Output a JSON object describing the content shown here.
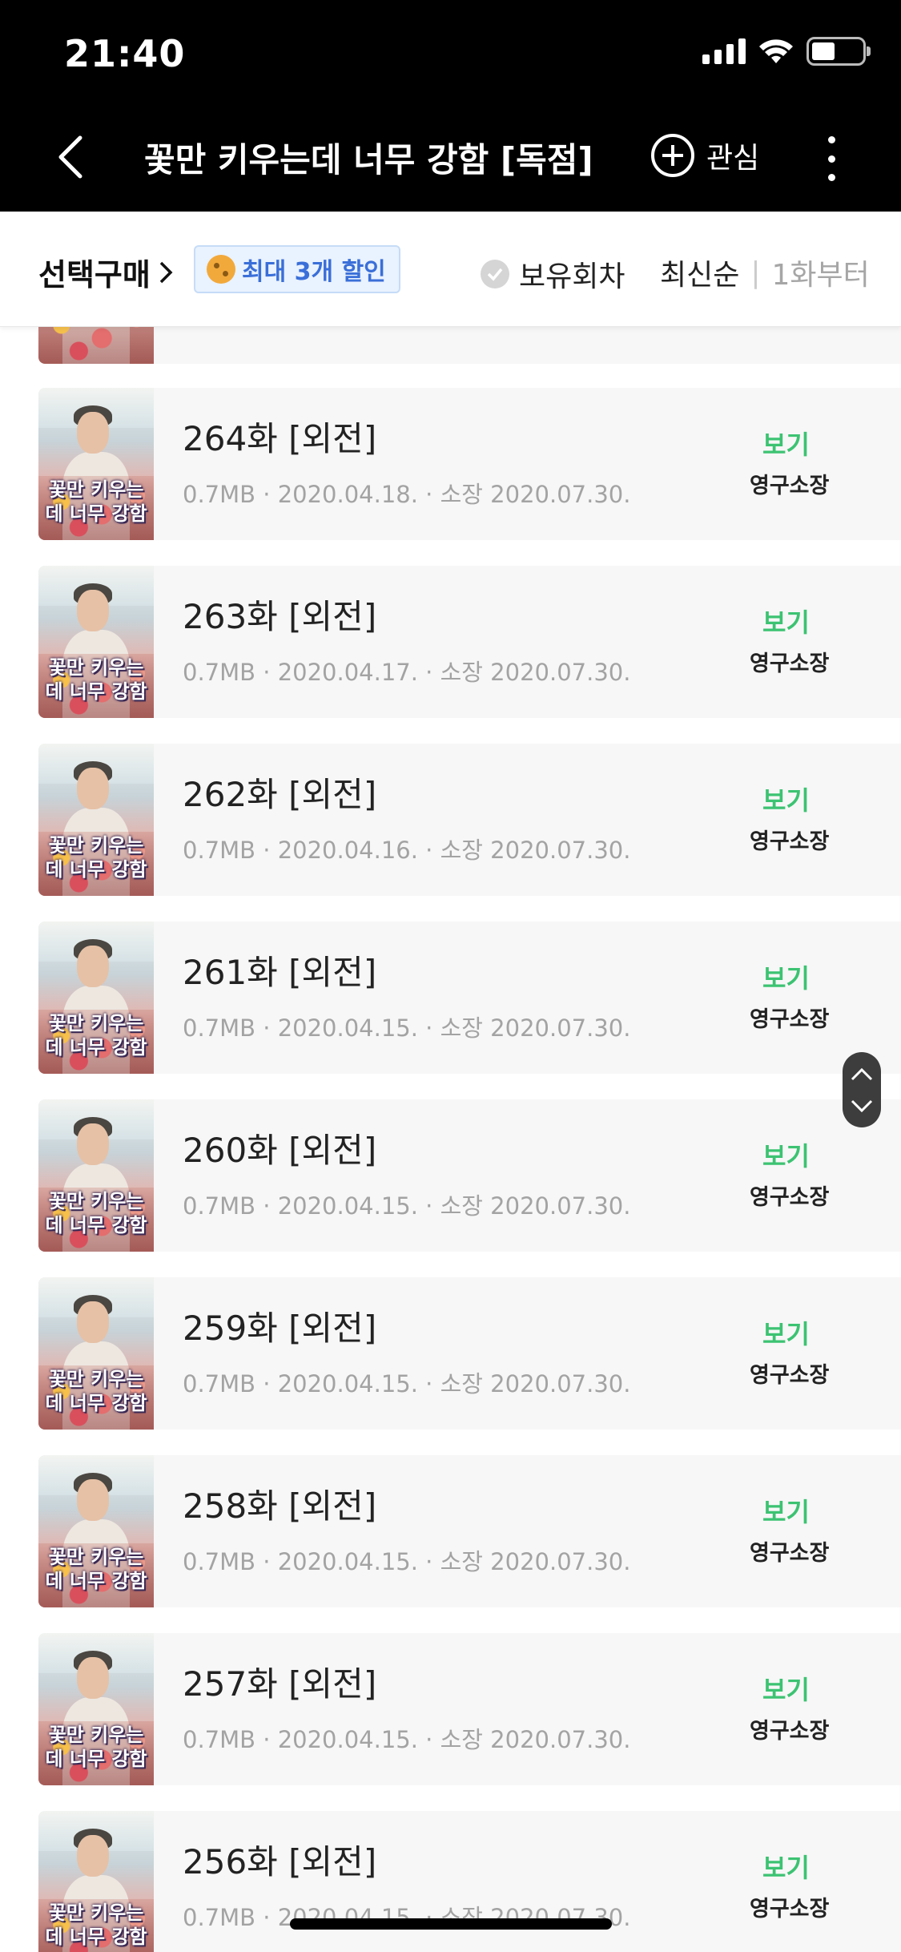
{
  "status_bar": {
    "time": "21:40"
  },
  "header": {
    "title": "꽃만 키우는데 너무 강함 [독점]",
    "favorite_label": "관심"
  },
  "filter_bar": {
    "select_buy": "선택구매",
    "discount_badge": "최대 3개 할인",
    "owned_label": "보유회차",
    "sort_latest": "최신순",
    "sort_first": "1화부터"
  },
  "thumbnail_logo": "꽃만 키우는데 너무 강함",
  "episodes": [
    {
      "title": "264화 [외전]",
      "meta": "0.7MB · 2020.04.18. · 소장 2020.07.30.",
      "action": "보기",
      "ownership": "영구소장"
    },
    {
      "title": "263화 [외전]",
      "meta": "0.7MB · 2020.04.17. · 소장 2020.07.30.",
      "action": "보기",
      "ownership": "영구소장"
    },
    {
      "title": "262화 [외전]",
      "meta": "0.7MB · 2020.04.16. · 소장 2020.07.30.",
      "action": "보기",
      "ownership": "영구소장"
    },
    {
      "title": "261화 [외전]",
      "meta": "0.7MB · 2020.04.15. · 소장 2020.07.30.",
      "action": "보기",
      "ownership": "영구소장"
    },
    {
      "title": "260화 [외전]",
      "meta": "0.7MB · 2020.04.15. · 소장 2020.07.30.",
      "action": "보기",
      "ownership": "영구소장"
    },
    {
      "title": "259화 [외전]",
      "meta": "0.7MB · 2020.04.15. · 소장 2020.07.30.",
      "action": "보기",
      "ownership": "영구소장"
    },
    {
      "title": "258화 [외전]",
      "meta": "0.7MB · 2020.04.15. · 소장 2020.07.30.",
      "action": "보기",
      "ownership": "영구소장"
    },
    {
      "title": "257화 [외전]",
      "meta": "0.7MB · 2020.04.15. · 소장 2020.07.30.",
      "action": "보기",
      "ownership": "영구소장"
    },
    {
      "title": "256화 [외전]",
      "meta": "0.7MB · 2020.04.15. · 소장 2020.07.30.",
      "action": "보기",
      "ownership": "영구소장"
    }
  ],
  "colors": {
    "header_bg": "#000000",
    "view_green": "#3cc372",
    "discount_blue": "#3a6fd8",
    "row_bg": "#f7f7f7"
  }
}
